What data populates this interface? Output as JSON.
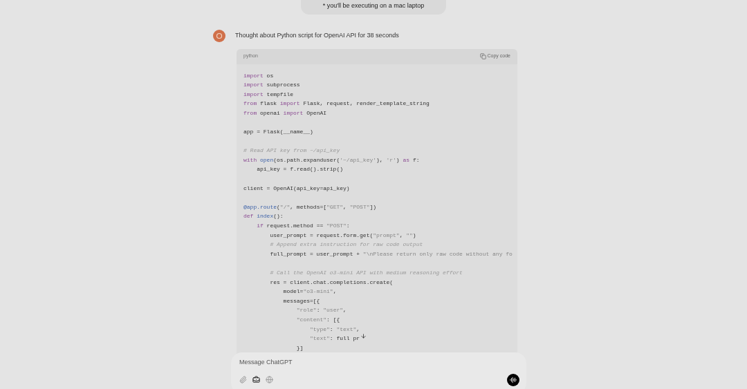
{
  "user_message": "* you'll be executing on a mac laptop",
  "assistant": {
    "thought": "Thought about Python script for OpenAI API for 38 seconds"
  },
  "code_block": {
    "language": "python",
    "copy_label": "Copy code",
    "lines": [
      {
        "kind": "code",
        "tokens": [
          {
            "text": "import",
            "kind": "keyword"
          },
          {
            "text": " os",
            "kind": "plain"
          }
        ]
      },
      {
        "kind": "code",
        "tokens": [
          {
            "text": "import",
            "kind": "keyword"
          },
          {
            "text": " subprocess",
            "kind": "plain"
          }
        ]
      },
      {
        "kind": "code",
        "tokens": [
          {
            "text": "import",
            "kind": "keyword"
          },
          {
            "text": " tempfile",
            "kind": "plain"
          }
        ]
      },
      {
        "kind": "code",
        "tokens": [
          {
            "text": "from",
            "kind": "keyword"
          },
          {
            "text": " flask ",
            "kind": "plain"
          },
          {
            "text": "import",
            "kind": "keyword"
          },
          {
            "text": " Flask, request, render_template_string",
            "kind": "plain"
          }
        ]
      },
      {
        "kind": "code",
        "tokens": [
          {
            "text": "from",
            "kind": "keyword"
          },
          {
            "text": " openai ",
            "kind": "plain"
          },
          {
            "text": "import",
            "kind": "keyword"
          },
          {
            "text": " OpenAI",
            "kind": "plain"
          }
        ]
      },
      {
        "kind": "blank"
      },
      {
        "kind": "code",
        "tokens": [
          {
            "text": "app = Flask(__name__)",
            "kind": "plain"
          }
        ]
      },
      {
        "kind": "blank"
      },
      {
        "kind": "code",
        "tokens": [
          {
            "text": "# Read API key from ~/api_key",
            "kind": "comment"
          }
        ]
      },
      {
        "kind": "code",
        "tokens": [
          {
            "text": "with",
            "kind": "keyword"
          },
          {
            "text": " open",
            "kind": "function"
          },
          {
            "text": "(os.path.expanduser(",
            "kind": "plain"
          },
          {
            "text": "'~/api_key'",
            "kind": "string"
          },
          {
            "text": "), ",
            "kind": "plain"
          },
          {
            "text": "'r'",
            "kind": "string"
          },
          {
            "text": ") ",
            "kind": "plain"
          },
          {
            "text": "as",
            "kind": "keyword"
          },
          {
            "text": " f:",
            "kind": "plain"
          }
        ]
      },
      {
        "kind": "code",
        "tokens": [
          {
            "text": "    api_key = f.read().strip()",
            "kind": "plain"
          }
        ]
      },
      {
        "kind": "blank"
      },
      {
        "kind": "code",
        "tokens": [
          {
            "text": "client = OpenAI(api_key=api_key)",
            "kind": "plain"
          }
        ]
      },
      {
        "kind": "blank"
      },
      {
        "kind": "code",
        "tokens": [
          {
            "text": "@app.route",
            "kind": "function"
          },
          {
            "text": "(",
            "kind": "plain"
          },
          {
            "text": "\"/\"",
            "kind": "string"
          },
          {
            "text": ", methods=[",
            "kind": "plain"
          },
          {
            "text": "\"GET\"",
            "kind": "string"
          },
          {
            "text": ", ",
            "kind": "plain"
          },
          {
            "text": "\"POST\"",
            "kind": "string"
          },
          {
            "text": "])",
            "kind": "plain"
          }
        ]
      },
      {
        "kind": "code",
        "tokens": [
          {
            "text": "def",
            "kind": "keyword"
          },
          {
            "text": " index",
            "kind": "function"
          },
          {
            "text": "():",
            "kind": "plain"
          }
        ]
      },
      {
        "kind": "code",
        "tokens": [
          {
            "text": "    if",
            "kind": "keyword"
          },
          {
            "text": " request.method == ",
            "kind": "plain"
          },
          {
            "text": "\"POST\"",
            "kind": "string"
          },
          {
            "text": ":",
            "kind": "plain"
          }
        ]
      },
      {
        "kind": "code",
        "tokens": [
          {
            "text": "        user_prompt = request.form.get(",
            "kind": "plain"
          },
          {
            "text": "\"prompt\"",
            "kind": "string"
          },
          {
            "text": ", ",
            "kind": "plain"
          },
          {
            "text": "\"\"",
            "kind": "string"
          },
          {
            "text": ")",
            "kind": "plain"
          }
        ]
      },
      {
        "kind": "code",
        "tokens": [
          {
            "text": "        # Append extra instruction for raw code output",
            "kind": "comment"
          }
        ]
      },
      {
        "kind": "code",
        "tokens": [
          {
            "text": "        full_prompt = user_prompt + ",
            "kind": "plain"
          },
          {
            "text": "\"\\nPlease return only raw code without any fo",
            "kind": "string"
          }
        ]
      },
      {
        "kind": "blank"
      },
      {
        "kind": "code",
        "tokens": [
          {
            "text": "        # Call the OpenAI o3-mini API with medium reasoning effort",
            "kind": "comment"
          }
        ]
      },
      {
        "kind": "code",
        "tokens": [
          {
            "text": "        res = client.chat.completions.create(",
            "kind": "plain"
          }
        ]
      },
      {
        "kind": "code",
        "tokens": [
          {
            "text": "            model=",
            "kind": "plain"
          },
          {
            "text": "\"o3-mini\"",
            "kind": "string"
          },
          {
            "text": ",",
            "kind": "plain"
          }
        ]
      },
      {
        "kind": "code",
        "tokens": [
          {
            "text": "            messages=[{",
            "kind": "plain"
          }
        ]
      },
      {
        "kind": "code",
        "tokens": [
          {
            "text": "                \"role\"",
            "kind": "string"
          },
          {
            "text": ": ",
            "kind": "plain"
          },
          {
            "text": "\"user\"",
            "kind": "string"
          },
          {
            "text": ",",
            "kind": "plain"
          }
        ]
      },
      {
        "kind": "code",
        "tokens": [
          {
            "text": "                \"content\"",
            "kind": "string"
          },
          {
            "text": ": [{",
            "kind": "plain"
          }
        ]
      },
      {
        "kind": "code",
        "tokens": [
          {
            "text": "                    \"type\"",
            "kind": "string"
          },
          {
            "text": ": ",
            "kind": "plain"
          },
          {
            "text": "\"text\"",
            "kind": "string"
          },
          {
            "text": ",",
            "kind": "plain"
          }
        ]
      },
      {
        "kind": "code",
        "tokens": [
          {
            "text": "                    \"text\"",
            "kind": "string"
          },
          {
            "text": ": full pr",
            "kind": "plain"
          }
        ]
      },
      {
        "kind": "code",
        "tokens": [
          {
            "text": "                }]",
            "kind": "plain"
          }
        ]
      }
    ]
  },
  "composer": {
    "placeholder": "Message ChatGPT"
  }
}
